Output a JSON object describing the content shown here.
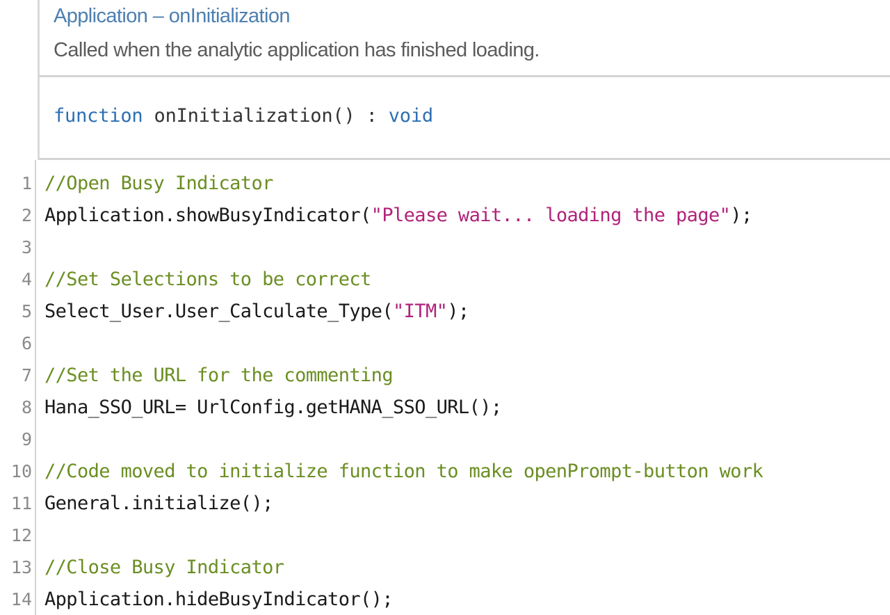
{
  "header": {
    "event_title": "Application – onInitialization",
    "event_description": "Called when the analytic application has finished loading."
  },
  "signature": {
    "keyword": "function",
    "name": "onInitialization()",
    "separator": ":",
    "return_type": "void"
  },
  "editor": {
    "line_numbers": [
      "1",
      "2",
      "3",
      "4",
      "5",
      "6",
      "7",
      "8",
      "9",
      "10",
      "11",
      "12",
      "13",
      "14"
    ],
    "lines": [
      {
        "text": "//Open Busy Indicator"
      },
      {
        "prefix": "Application.showBusyIndicator(",
        "string": "\"Please wait... loading the page\"",
        "suffix": ");"
      },
      {
        "text": ""
      },
      {
        "text": "//Set Selections to be correct"
      },
      {
        "prefix": "Select_User.User_Calculate_Type(",
        "string": "\"ITM\"",
        "suffix": ");"
      },
      {
        "text": ""
      },
      {
        "text": "//Set the URL for the commenting"
      },
      {
        "text": "Hana_SSO_URL= UrlConfig.getHANA_SSO_URL();"
      },
      {
        "text": ""
      },
      {
        "text": "//Code moved to initialize function to make openPrompt-button work"
      },
      {
        "text": "General.initialize();"
      },
      {
        "text": ""
      },
      {
        "text": "//Close Busy Indicator"
      },
      {
        "text": "Application.hideBusyIndicator();"
      }
    ]
  },
  "colors": {
    "comment": "#6b8e23",
    "string": "#b0237a",
    "keyword": "#2c6fb3",
    "title": "#4d7fb0"
  }
}
